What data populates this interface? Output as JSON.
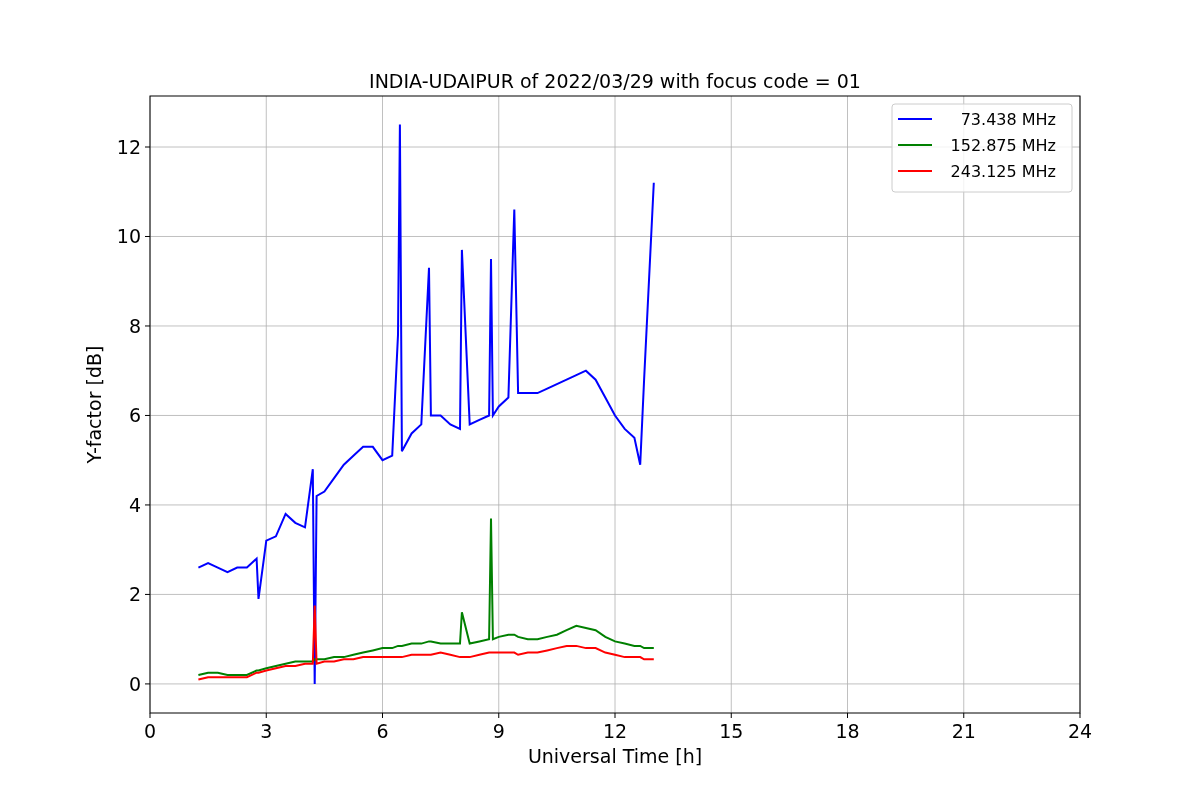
{
  "chart_data": {
    "type": "line",
    "title": "INDIA-UDAIPUR of 2022/03/29 with focus code = 01",
    "xlabel": "Universal Time [h]",
    "ylabel": "Y-factor [dB]",
    "x": [
      1.25,
      1.5,
      1.75,
      2.0,
      2.25,
      2.5,
      2.75,
      2.8,
      3.0,
      3.25,
      3.5,
      3.75,
      4.0,
      4.2,
      4.25,
      4.3,
      4.5,
      4.75,
      5.0,
      5.25,
      5.5,
      5.75,
      6.0,
      6.25,
      6.4,
      6.45,
      6.5,
      6.75,
      7.0,
      7.2,
      7.25,
      7.5,
      7.75,
      8.0,
      8.05,
      8.25,
      8.5,
      8.75,
      8.8,
      8.85,
      9.0,
      9.25,
      9.4,
      9.5,
      9.75,
      10.0,
      10.25,
      10.5,
      10.75,
      11.0,
      11.25,
      11.5,
      11.75,
      12.0,
      12.25,
      12.5,
      12.65,
      12.75,
      13.0
    ],
    "series": [
      {
        "name": "73.438 MHz",
        "color": "#0000ff",
        "values": [
          2.6,
          2.7,
          2.6,
          2.5,
          2.6,
          2.6,
          2.8,
          1.9,
          3.2,
          3.3,
          3.8,
          3.6,
          3.5,
          4.8,
          0.0,
          4.2,
          4.3,
          4.6,
          4.9,
          5.1,
          5.3,
          5.3,
          5.0,
          5.1,
          7.8,
          12.5,
          5.2,
          5.6,
          5.8,
          9.3,
          6.0,
          6.0,
          5.8,
          5.7,
          9.7,
          5.8,
          5.9,
          6.0,
          9.5,
          6.0,
          6.2,
          6.4,
          10.6,
          6.5,
          6.5,
          6.5,
          6.6,
          6.7,
          6.8,
          6.9,
          7.0,
          6.8,
          6.4,
          6.0,
          5.7,
          5.5,
          4.9,
          6.8,
          11.2
        ]
      },
      {
        "name": "152.875 MHz",
        "color": "#008000",
        "values": [
          0.2,
          0.25,
          0.25,
          0.2,
          0.2,
          0.2,
          0.3,
          0.3,
          0.35,
          0.4,
          0.45,
          0.5,
          0.5,
          0.5,
          0.55,
          0.55,
          0.55,
          0.6,
          0.6,
          0.65,
          0.7,
          0.75,
          0.8,
          0.8,
          0.85,
          0.85,
          0.85,
          0.9,
          0.9,
          0.95,
          0.95,
          0.9,
          0.9,
          0.9,
          1.6,
          0.9,
          0.95,
          1.0,
          3.7,
          1.0,
          1.05,
          1.1,
          1.1,
          1.05,
          1.0,
          1.0,
          1.05,
          1.1,
          1.2,
          1.3,
          1.25,
          1.2,
          1.05,
          0.95,
          0.9,
          0.85,
          0.85,
          0.8,
          0.8
        ]
      },
      {
        "name": "243.125 MHz",
        "color": "#ff0000",
        "values": [
          0.1,
          0.15,
          0.15,
          0.15,
          0.15,
          0.15,
          0.25,
          0.25,
          0.3,
          0.35,
          0.4,
          0.4,
          0.45,
          0.45,
          1.75,
          0.45,
          0.5,
          0.5,
          0.55,
          0.55,
          0.6,
          0.6,
          0.6,
          0.6,
          0.6,
          0.6,
          0.6,
          0.65,
          0.65,
          0.65,
          0.65,
          0.7,
          0.65,
          0.6,
          0.6,
          0.6,
          0.65,
          0.7,
          0.7,
          0.7,
          0.7,
          0.7,
          0.7,
          0.65,
          0.7,
          0.7,
          0.75,
          0.8,
          0.85,
          0.85,
          0.8,
          0.8,
          0.7,
          0.65,
          0.6,
          0.6,
          0.6,
          0.55,
          0.55
        ]
      }
    ],
    "xlim": [
      0,
      24
    ],
    "ylim": [
      -0.65,
      13.14
    ],
    "xticks": [
      0,
      3,
      6,
      9,
      12,
      15,
      18,
      21,
      24
    ],
    "yticks": [
      0,
      2,
      4,
      6,
      8,
      10,
      12
    ],
    "grid": true,
    "legend": true
  }
}
